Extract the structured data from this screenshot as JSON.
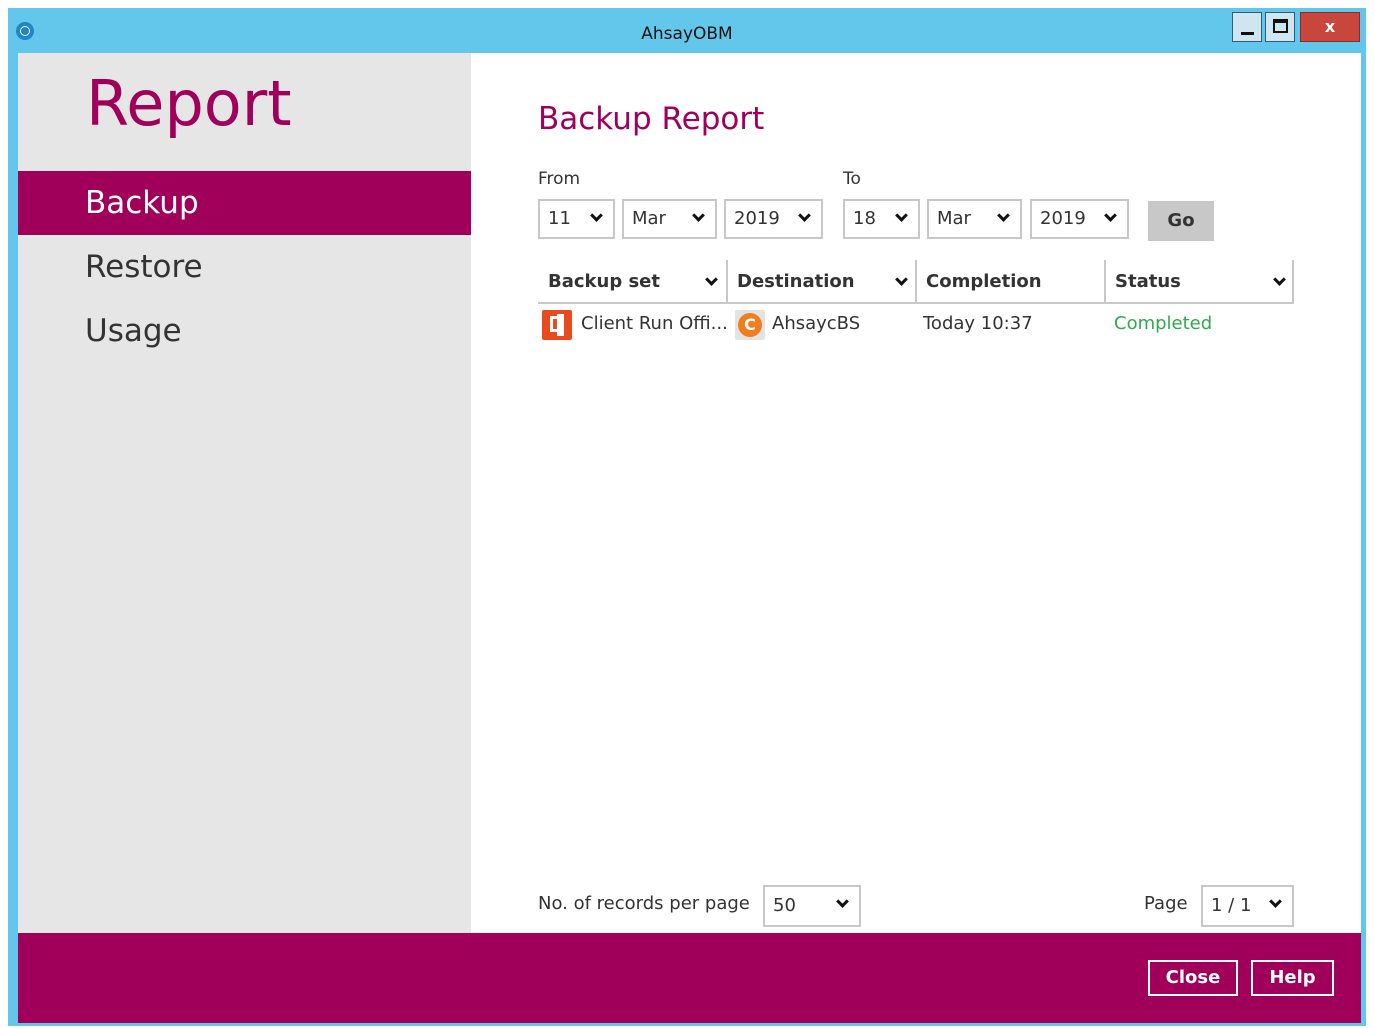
{
  "window": {
    "title": "AhsayOBM"
  },
  "sidebar": {
    "heading": "Report",
    "items": [
      {
        "label": "Backup",
        "active": true
      },
      {
        "label": "Restore",
        "active": false
      },
      {
        "label": "Usage",
        "active": false
      }
    ]
  },
  "main": {
    "title": "Backup Report",
    "from_label": "From",
    "to_label": "To",
    "from": {
      "day": "11",
      "month": "Mar",
      "year": "2019"
    },
    "to": {
      "day": "18",
      "month": "Mar",
      "year": "2019"
    },
    "go_label": "Go"
  },
  "table": {
    "columns": [
      "Backup set",
      "Destination",
      "Completion",
      "Status"
    ],
    "rows": [
      {
        "backup_set": "Client Run Offi...",
        "destination": "AhsaycBS",
        "completion": "Today 10:37",
        "status": "Completed",
        "backup_set_icon": "office365-icon",
        "destination_icon": "ahsay-cbs-icon"
      }
    ]
  },
  "pagination": {
    "records_label": "No. of records per page",
    "records_value": "50",
    "page_label": "Page",
    "page_value": "1 / 1"
  },
  "footer": {
    "close_label": "Close",
    "help_label": "Help"
  },
  "colors": {
    "accent": "#a0005a",
    "titlebar": "#62c7ea",
    "status_ok": "#2eaa4e",
    "sidebar_bg": "#e6e6e6"
  }
}
